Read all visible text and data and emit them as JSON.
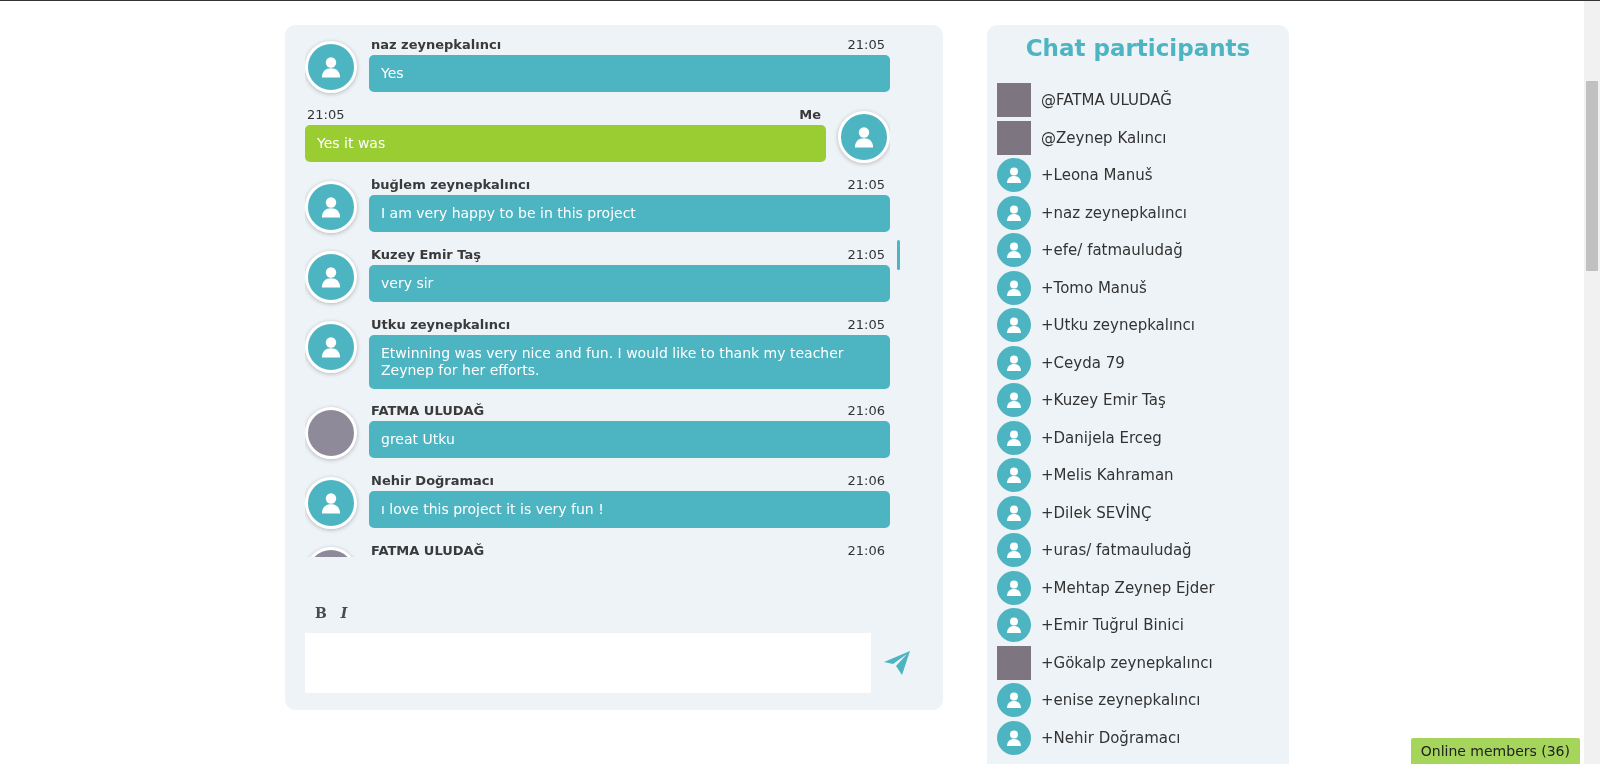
{
  "chat": {
    "messages": [
      {
        "kind": "other",
        "author": "naz zeynepkalıncı",
        "time": "21:05",
        "text": "Yes",
        "avatar": {
          "kind": "default"
        }
      },
      {
        "kind": "own",
        "author": "Me",
        "time": "21:05",
        "text": "Yes it was",
        "avatar": {
          "kind": "default"
        }
      },
      {
        "kind": "other",
        "author": "buğlem zeynepkalıncı",
        "time": "21:05",
        "text": "I am very happy to  be in this project",
        "avatar": {
          "kind": "default"
        }
      },
      {
        "kind": "other",
        "author": "Kuzey Emir Taş",
        "time": "21:05",
        "text": "very sir",
        "avatar": {
          "kind": "default"
        }
      },
      {
        "kind": "other",
        "author": "Utku zeynepkalıncı",
        "time": "21:05",
        "text": "Etwinning was very nice and fun. I would like to thank my teacher Zeynep for her efforts.",
        "avatar": {
          "kind": "default"
        }
      },
      {
        "kind": "other",
        "author": "FATMA ULUDAĞ",
        "time": "21:06",
        "text": "great Utku",
        "avatar": {
          "kind": "photo"
        }
      },
      {
        "kind": "other",
        "author": "Nehir Doğramacı",
        "time": "21:06",
        "text": "ı love this project it is very fun !",
        "avatar": {
          "kind": "default"
        }
      },
      {
        "kind": "other",
        "author": "FATMA ULUDAĞ",
        "time": "21:06",
        "avatar": {
          "kind": "photo"
        }
      }
    ],
    "toolbar": [
      {
        "kind": "bold",
        "label": "B"
      },
      {
        "kind": "italic",
        "label": "I"
      }
    ]
  },
  "participants": {
    "title": "Chat participants",
    "items": [
      {
        "name": "@FATMA ULUDAĞ",
        "avatar": {
          "kind": "photo"
        }
      },
      {
        "name": "@Zeynep Kalıncı",
        "avatar": {
          "kind": "photo"
        }
      },
      {
        "name": "+Leona Manuš",
        "avatar": {
          "kind": "default"
        }
      },
      {
        "name": "+naz zeynepkalıncı",
        "avatar": {
          "kind": "default"
        }
      },
      {
        "name": "+efe/ fatmauludağ",
        "avatar": {
          "kind": "default"
        }
      },
      {
        "name": "+Tomo Manuš",
        "avatar": {
          "kind": "default"
        }
      },
      {
        "name": "+Utku zeynepkalıncı",
        "avatar": {
          "kind": "default"
        }
      },
      {
        "name": "+Ceyda 79",
        "avatar": {
          "kind": "default"
        }
      },
      {
        "name": "+Kuzey Emir Taş",
        "avatar": {
          "kind": "default"
        }
      },
      {
        "name": "+Danijela Erceg",
        "avatar": {
          "kind": "default"
        }
      },
      {
        "name": "+Melis Kahraman",
        "avatar": {
          "kind": "default"
        }
      },
      {
        "name": "+Dilek SEVİNÇ",
        "avatar": {
          "kind": "default"
        }
      },
      {
        "name": "+uras/ fatmauludağ",
        "avatar": {
          "kind": "default"
        }
      },
      {
        "name": "+Mehtap Zeynep Ejder",
        "avatar": {
          "kind": "default"
        }
      },
      {
        "name": "+Emir Tuğrul Binici",
        "avatar": {
          "kind": "default"
        }
      },
      {
        "name": "+Gökalp zeynepkalıncı",
        "avatar": {
          "kind": "photo"
        }
      },
      {
        "name": "+enise zeynepkalıncı",
        "avatar": {
          "kind": "default"
        }
      },
      {
        "name": "+Nehir Doğramacı",
        "avatar": {
          "kind": "default"
        }
      }
    ]
  },
  "online_badge": {
    "label": "Online members (36)"
  }
}
